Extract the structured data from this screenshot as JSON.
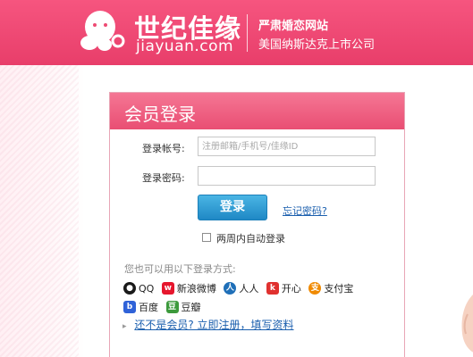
{
  "brand": {
    "name_cn": "世纪佳缘",
    "name_en": "jiayuan.com",
    "slogan_line1": "严肃婚恋网站",
    "slogan_line2": "美国纳斯达克上市公司"
  },
  "login": {
    "title": "会员登录",
    "account_label": "登录帐号:",
    "account_placeholder": "注册邮箱/手机号/佳缘ID",
    "password_label": "登录密码:",
    "login_button": "登录",
    "forgot_link": "忘记密码?",
    "remember_label": "两周内自动登录",
    "also_label": "您也可以用以下登录方式:",
    "register_link": "还不是会员? 立即注册，填写资料"
  },
  "providers_row1": [
    {
      "label": "QQ",
      "icon": "qq-icon",
      "color": "#1a1a1a"
    },
    {
      "label": "新浪微博",
      "icon": "weibo-icon",
      "color": "#e6162d"
    },
    {
      "label": "人人",
      "icon": "renren-icon",
      "color": "#1f6fb8"
    },
    {
      "label": "开心",
      "icon": "kaixin-icon",
      "color": "#e0312f"
    },
    {
      "label": "支付宝",
      "icon": "alipay-icon",
      "color": "#f08a00"
    }
  ],
  "providers_row2": [
    {
      "label": "百度",
      "icon": "baidu-icon",
      "color": "#2f62d8"
    },
    {
      "label": "豆瓣",
      "icon": "douban-icon",
      "color": "#3c9a3c"
    }
  ],
  "colors": {
    "header": "#ee4a73",
    "panel_head": "#f06385",
    "button": "#2a95d0",
    "link": "#1b5fae"
  }
}
